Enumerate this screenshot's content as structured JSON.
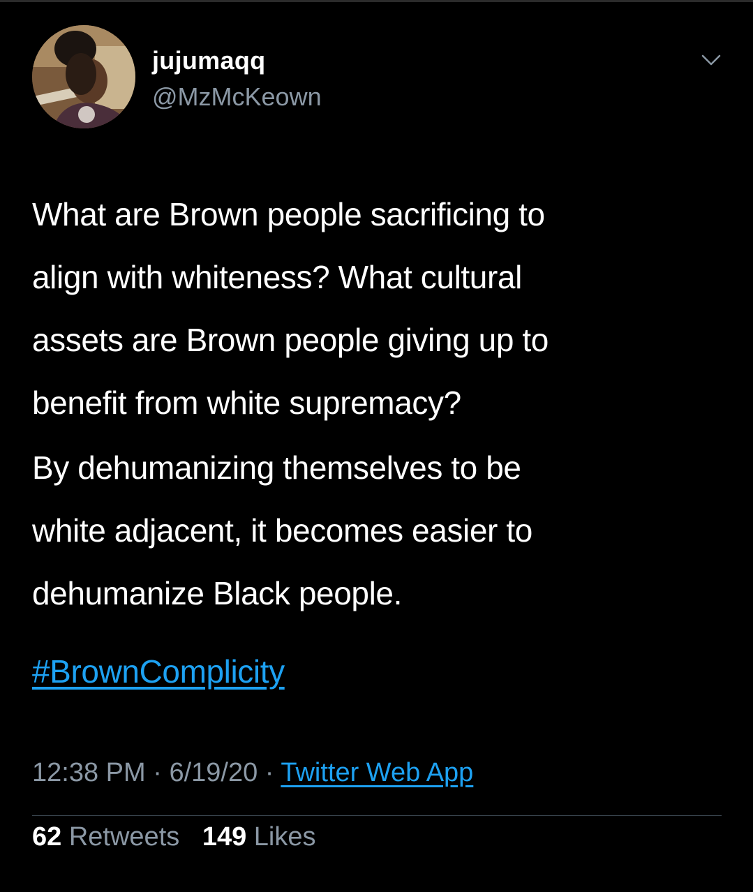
{
  "tweet": {
    "author": {
      "display_name": "jujumaqq",
      "handle": "@MzMcKeown",
      "avatar_icon": "profile-photo"
    },
    "menu_icon": "chevron-down-icon",
    "paragraphs": [
      "What are Brown people sacrificing to\nalign with whiteness? What cultural\nassets are Brown people giving up to\nbenefit from white supremacy?",
      "By dehumanizing themselves to be\nwhite adjacent, it becomes easier to\ndehumanize Black people."
    ],
    "hashtag": "#BrownComplicity",
    "time": "12:38 PM",
    "date": "6/19/20",
    "separator": "·",
    "source": "Twitter Web App",
    "retweets_count": "62",
    "retweets_label": "Retweets",
    "likes_count": "149",
    "likes_label": "Likes"
  },
  "colors": {
    "background": "#000000",
    "text": "#ffffff",
    "secondary": "#8b98a5",
    "link": "#1da1f2",
    "divider": "#38444d"
  }
}
